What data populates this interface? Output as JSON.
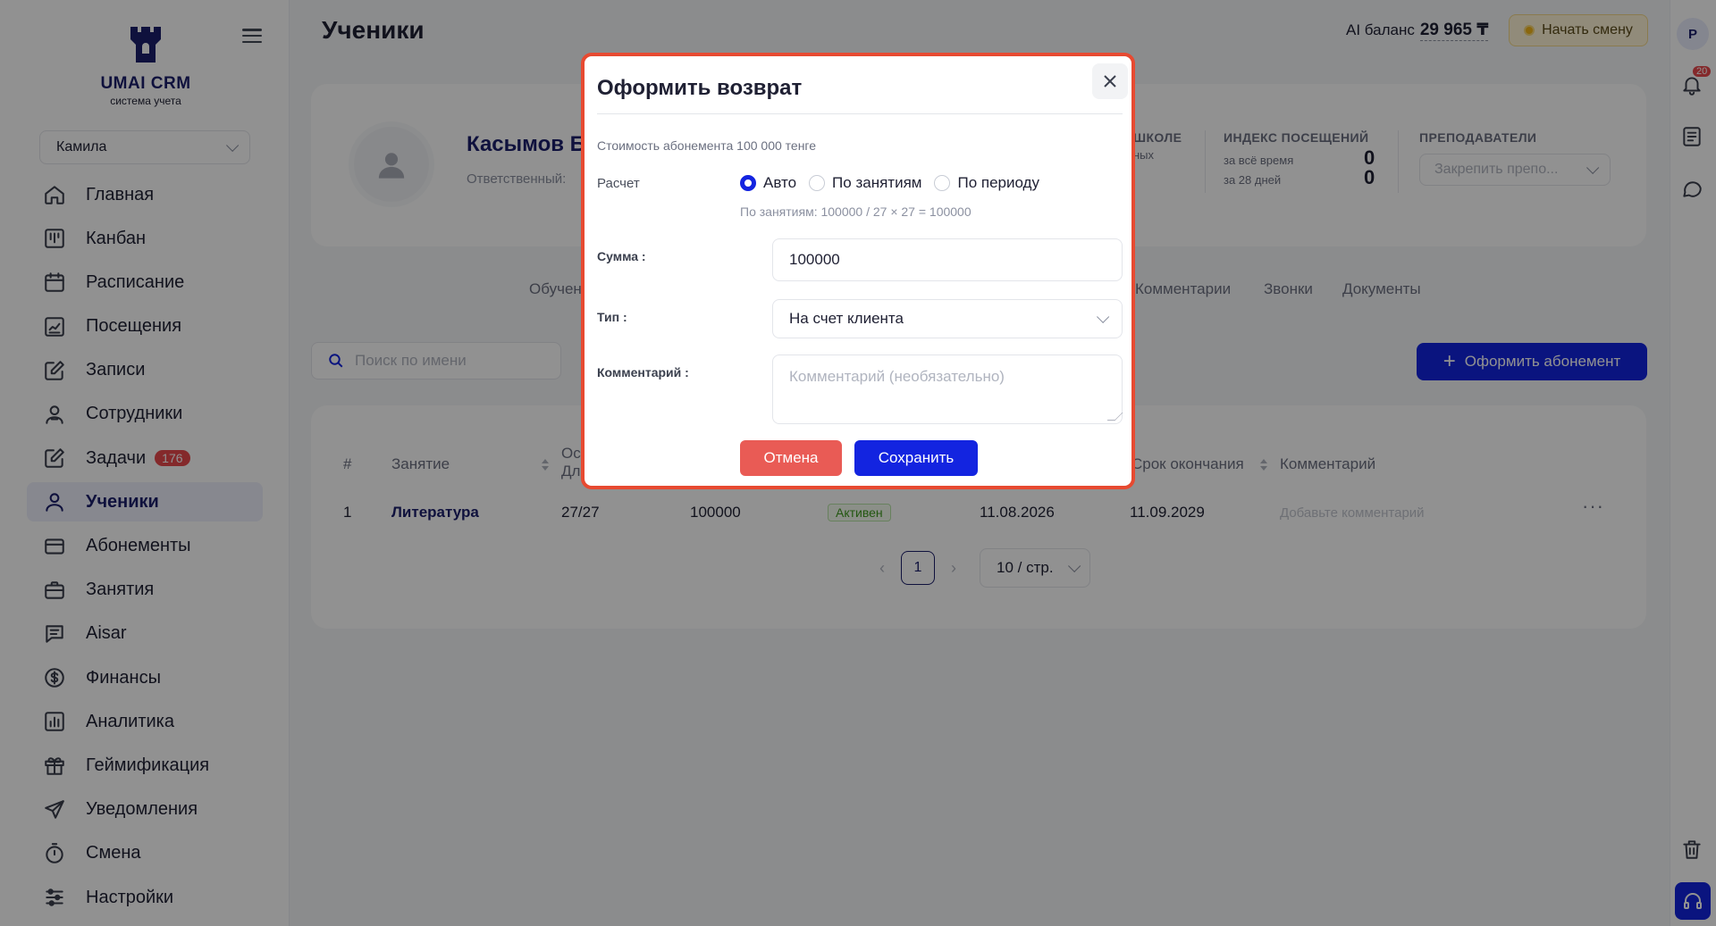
{
  "app": {
    "logo_title": "UMAI CRM",
    "logo_subtitle": "система учета",
    "user": "Камила",
    "page_title": "Ученики",
    "ai_balance_label": "AI баланс",
    "ai_balance_value": "29 965 ₸",
    "start_shift": "Начать смену",
    "avatar_letter": "P",
    "notifications_count": "20"
  },
  "sidebar": {
    "items": [
      {
        "label": "Главная",
        "icon": "home-icon"
      },
      {
        "label": "Канбан",
        "icon": "kanban-icon"
      },
      {
        "label": "Расписание",
        "icon": "calendar-icon"
      },
      {
        "label": "Посещения",
        "icon": "attendance-chart-icon"
      },
      {
        "label": "Записи",
        "icon": "edit-note-icon"
      },
      {
        "label": "Сотрудники",
        "icon": "staff-icon"
      },
      {
        "label": "Задачи",
        "icon": "tasks-icon",
        "badge": "176"
      },
      {
        "label": "Ученики",
        "icon": "student-icon",
        "active": true
      },
      {
        "label": "Абонементы",
        "icon": "card-icon"
      },
      {
        "label": "Занятия",
        "icon": "briefcase-icon"
      },
      {
        "label": "Aisar",
        "icon": "chat-icon"
      },
      {
        "label": "Финансы",
        "icon": "dollar-icon"
      },
      {
        "label": "Аналитика",
        "icon": "analytics-icon"
      },
      {
        "label": "Геймификация",
        "icon": "gift-icon"
      },
      {
        "label": "Уведомления",
        "icon": "send-icon"
      },
      {
        "label": "Смена",
        "icon": "stopwatch-icon"
      },
      {
        "label": "Настройки",
        "icon": "sliders-icon"
      }
    ]
  },
  "profile": {
    "name": "Касымов Б",
    "responsible_label": "Ответственный:",
    "school_head": "ШКОЛЕ",
    "school_sub": "ных",
    "visits_head": "ИНДЕКС ПОСЕЩЕНИЙ",
    "visits_all_label": "за всё время",
    "visits_all_value": "0",
    "visits_28_label": "за 28 дней",
    "visits_28_value": "0",
    "teachers_head": "ПРЕПОДАВАТЕЛИ",
    "teachers_placeholder": "Закрепить препо..."
  },
  "tabs": [
    "Обучен",
    "Комментарии",
    "Звонки",
    "Документы"
  ],
  "search_placeholder": "Поиск по имени",
  "add_subscription": "Оформить абонемент",
  "table": {
    "headers": [
      "#",
      "Занятие",
      "Ос",
      "Дл",
      "Срок окончания",
      "Комментарий"
    ],
    "row": {
      "num": "1",
      "lesson": "Литература",
      "remaining": "27/27",
      "price": "100000",
      "status": "Активен",
      "start": "11.08.2026",
      "end": "11.09.2029",
      "comment_placeholder": "Добавьте комментарий"
    },
    "page": "1",
    "page_size": "10 / стр."
  },
  "modal": {
    "title": "Оформить возврат",
    "cost_text": "Стоимость абонемента 100 000 тенге",
    "calc_label": "Расчет",
    "radio_options": [
      "Авто",
      "По занятиям",
      "По периоду"
    ],
    "radio_selected": "Авто",
    "hint": "По занятиям: 100000 / 27 × 27 = 100000",
    "sum_label": "Сумма :",
    "sum_value": "100000",
    "type_label": "Тип :",
    "type_value": "На счет клиента",
    "comment_label": "Комментарий :",
    "comment_placeholder": "Комментарий (необязательно)",
    "cancel": "Отмена",
    "save": "Сохранить"
  },
  "colors": {
    "accent": "#1324e0",
    "brand_dark": "#1c1f6b",
    "danger": "#e95b55",
    "modal_border": "#e74a31"
  }
}
